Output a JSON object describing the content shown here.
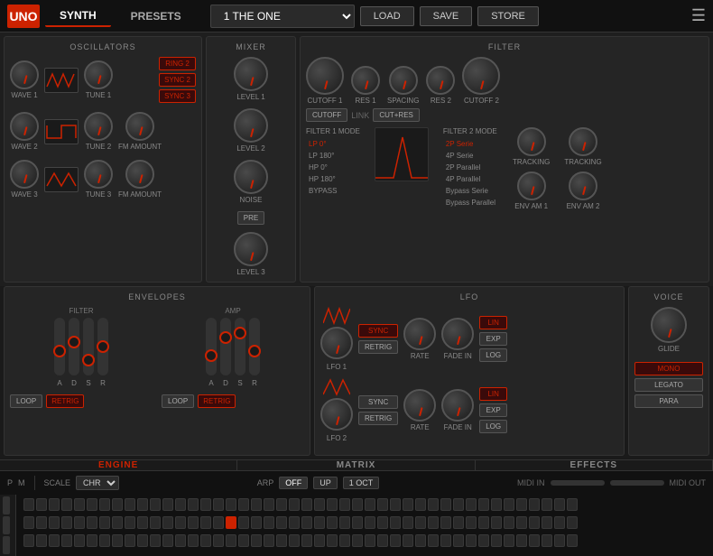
{
  "topbar": {
    "logo": "UNO",
    "tabs": [
      "SYNTH",
      "PRESETS"
    ],
    "active_tab": "SYNTH",
    "preset_name": "1 THE ONE",
    "buttons": [
      "LOAD",
      "SAVE",
      "STORE"
    ]
  },
  "oscillators": {
    "title": "OSCILLATORS",
    "rows": [
      {
        "label": "WAVE 1",
        "tune_label": "TUNE 1"
      },
      {
        "label": "WAVE 2",
        "tune_label": "TUNE 2",
        "fm_label": "FM AMOUNT"
      },
      {
        "label": "WAVE 3",
        "tune_label": "TUNE 3",
        "fm_label": "FM AMOUNT"
      }
    ],
    "buttons": [
      "RING 2",
      "SYNC 2",
      "SYNC 3"
    ]
  },
  "mixer": {
    "title": "MIXER",
    "labels": [
      "LEVEL 1",
      "LEVEL 2",
      "LEVEL 3"
    ],
    "noise_label": "NOISE",
    "pre_label": "PRE"
  },
  "filter": {
    "title": "FILTER",
    "knobs": [
      "CUTOFF 1",
      "RES 1",
      "SPACING",
      "RES 2",
      "CUTOFF 2"
    ],
    "buttons": [
      "CUTOFF",
      "LINK",
      "CUT+RES"
    ],
    "mode1_title": "FILTER 1 MODE",
    "mode2_title": "FILTER 2 MODE",
    "mode1_items": [
      "LP 0°",
      "LP 180°",
      "HP 0°",
      "HP 180°",
      "BYPASS"
    ],
    "mode2_items": [
      "2P Serie",
      "4P Serie",
      "2P Parallel",
      "4P Parallel",
      "Bypass Serie",
      "Bypass Parallel"
    ],
    "tracking_label": "TRACKING",
    "env_am1_label": "ENV AM 1",
    "env_am2_label": "ENV AM 2"
  },
  "envelopes": {
    "title": "ENVELOPES",
    "filter_label": "FILTER",
    "amp_label": "AMP",
    "adsr": [
      "A",
      "D",
      "S",
      "R"
    ],
    "loop_label": "LOOP",
    "retrig_label": "RETRIG"
  },
  "lfo": {
    "title": "LFO",
    "lfo1_label": "LFO 1",
    "lfo2_label": "LFO 2",
    "rate_label": "RATE",
    "fade_in_label": "FADE IN",
    "sync_label": "SYNC",
    "retrig_label": "RETRIG",
    "lin_label": "LIN",
    "exp_label": "EXP",
    "log_label": "LOG"
  },
  "voice": {
    "title": "VOICE",
    "glide_label": "GLIDE",
    "buttons": [
      "MONO",
      "LEGATO",
      "PARA"
    ]
  },
  "bottom_tabs": [
    "ENGINE",
    "MATRIX",
    "EFFECTS"
  ],
  "sequencer": {
    "scale_label": "SCALE",
    "scale_value": "CHR",
    "arp_label": "ARP",
    "arp_off": "OFF",
    "arp_up": "UP",
    "arp_oct": "1 OCT",
    "midi_in": "MIDI IN",
    "midi_out": "MIDI OUT",
    "p_label": "P",
    "m_label": "M"
  }
}
